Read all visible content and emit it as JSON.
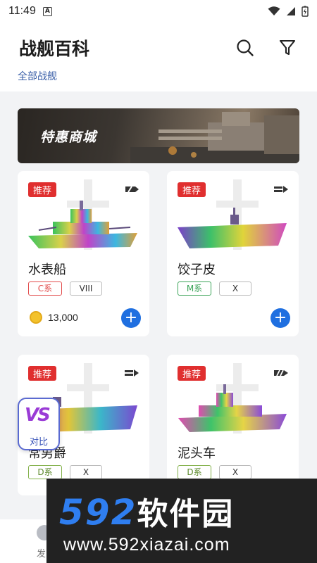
{
  "status_bar": {
    "time": "11:49",
    "a_icon": "A"
  },
  "header": {
    "title": "战舰百科",
    "sub_link": "全部战舰",
    "icons": [
      "search-icon",
      "filter-icon"
    ]
  },
  "banner": {
    "text": "特惠商城"
  },
  "cards": [
    {
      "badge": "推荐",
      "name": "水表船",
      "nation": "C系",
      "tier": "VIII",
      "price": "13,000",
      "type_icon": "battleship-icon"
    },
    {
      "badge": "推荐",
      "name": "饺子皮",
      "nation": "M系",
      "tier": "X",
      "type_icon": "carrier-icon"
    },
    {
      "badge": "推荐",
      "name": "常男爵",
      "nation": "D系",
      "tier": "X",
      "type_icon": "carrier-icon"
    },
    {
      "badge": "推荐",
      "name": "泥头车",
      "nation": "D系",
      "tier": "X",
      "type_icon": "cruiser-icon"
    }
  ],
  "compare": {
    "logo": "VS",
    "label": "对比"
  },
  "bottom_bar": {
    "tab_label": "发"
  },
  "site_watermark": {
    "brand_num": "592",
    "brand_cn": "软件园",
    "url": "www.592xiazai.com"
  },
  "colors": {
    "badge": "#e02f2f",
    "add_button": "#1f6fe0",
    "link": "#3a5fa8",
    "accent_purple": "#9a3bd6"
  }
}
